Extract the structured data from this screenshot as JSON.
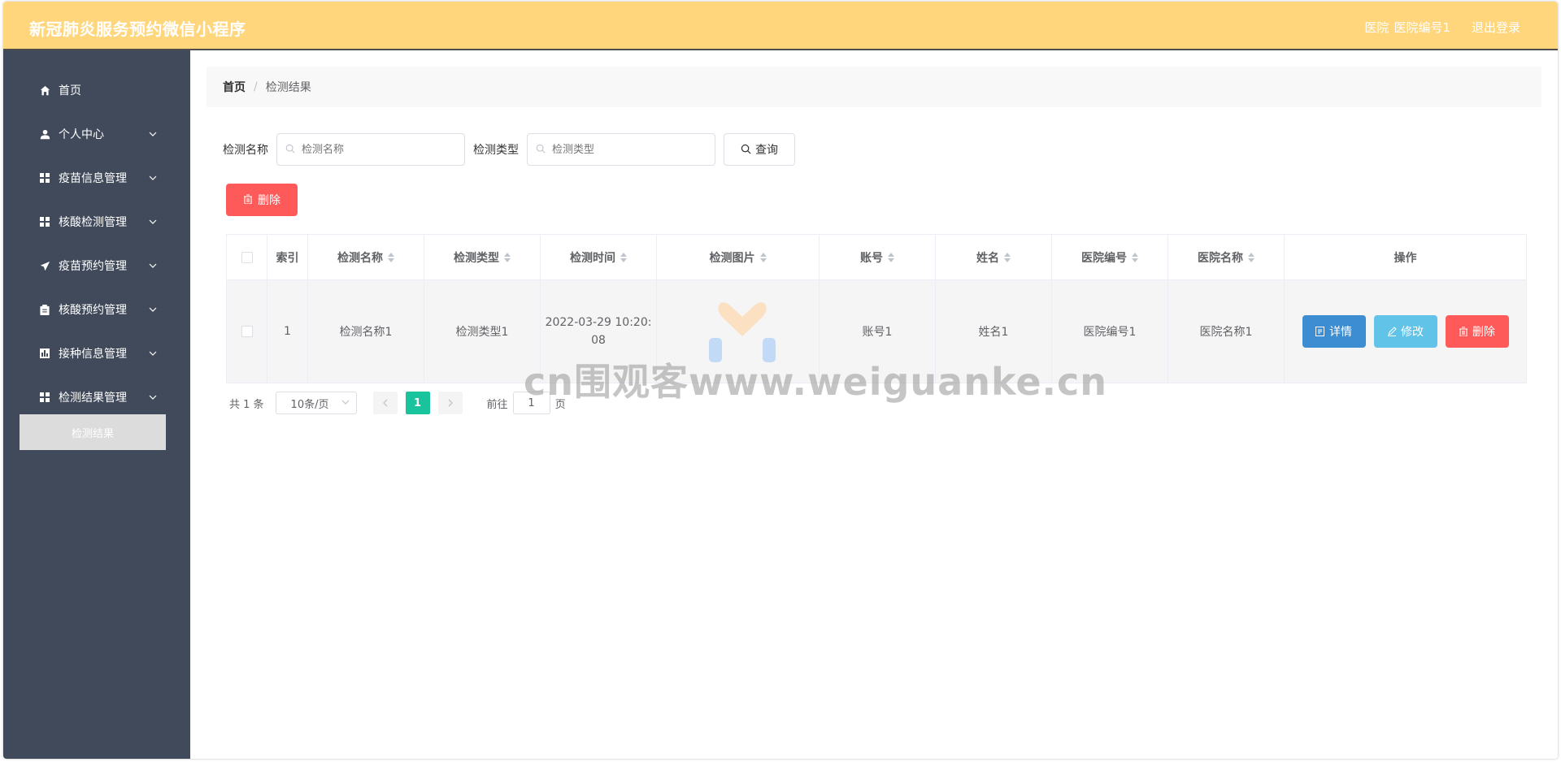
{
  "header": {
    "title": "新冠肺炎服务预约微信小程序",
    "role": "医院",
    "user": "医院编号1",
    "logout": "退出登录"
  },
  "sidebar": {
    "items": [
      {
        "label": "首页",
        "icon": "home-icon"
      },
      {
        "label": "个人中心",
        "icon": "user-icon"
      },
      {
        "label": "疫苗信息管理",
        "icon": "grid-icon"
      },
      {
        "label": "核酸检测管理",
        "icon": "grid-icon"
      },
      {
        "label": "疫苗预约管理",
        "icon": "send-icon"
      },
      {
        "label": "核酸预约管理",
        "icon": "clipboard-icon"
      },
      {
        "label": "接种信息管理",
        "icon": "chart-icon"
      },
      {
        "label": "检测结果管理",
        "icon": "grid-icon"
      }
    ],
    "active_sub": "检测结果"
  },
  "breadcrumb": {
    "home": "首页",
    "sep": "/",
    "current": "检测结果"
  },
  "search": {
    "name_label": "检测名称",
    "name_placeholder": "检测名称",
    "type_label": "检测类型",
    "type_placeholder": "检测类型",
    "query_label": "查询"
  },
  "toolbar": {
    "delete_label": "删除"
  },
  "table": {
    "columns": [
      "索引",
      "检测名称",
      "检测类型",
      "检测时间",
      "检测图片",
      "账号",
      "姓名",
      "医院编号",
      "医院名称",
      "操作"
    ],
    "rows": [
      {
        "index": "1",
        "name": "检测名称1",
        "type": "检测类型1",
        "time_line1": "2022-03-29 10:20:",
        "time_line2": "08",
        "account": "账号1",
        "person": "姓名1",
        "hospital_code": "医院编号1",
        "hospital_name": "医院名称1",
        "detail": "详情",
        "edit": "修改",
        "delete": "删除"
      }
    ]
  },
  "pagination": {
    "total": "共 1 条",
    "page_size": "10条/页",
    "current": "1",
    "goto_prefix": "前往",
    "goto_value": "1",
    "goto_suffix": "页"
  },
  "watermark": "cn围观客www.weiguanke.cn",
  "colors": {
    "header": "#ffd67b",
    "sidebar": "#404a5a",
    "danger": "#ff5a5a",
    "primary": "#3c8dd2",
    "info": "#62c3e8",
    "page_active": "#19c39c"
  }
}
